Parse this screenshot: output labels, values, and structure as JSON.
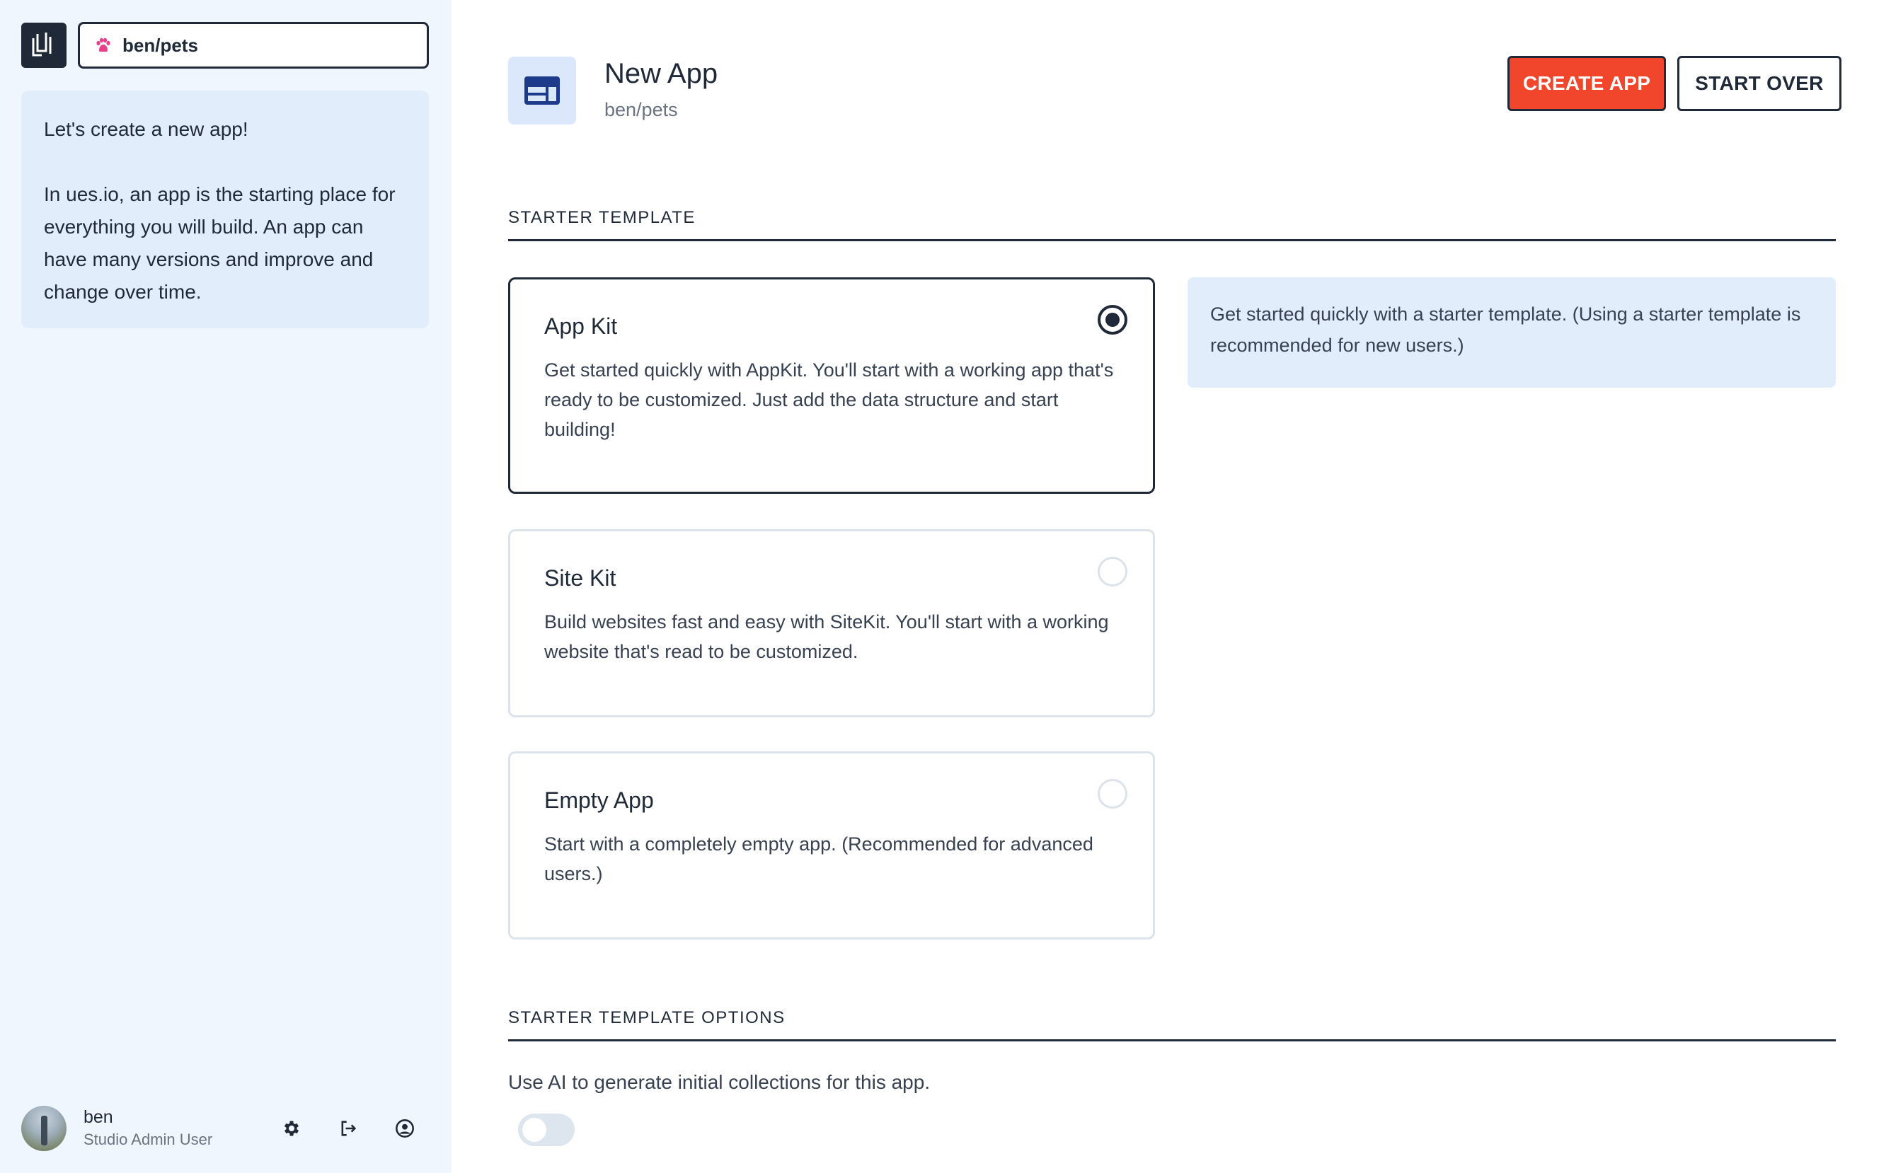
{
  "sidebar": {
    "app_selector": {
      "value": "ben/pets",
      "icon": "paw-icon"
    },
    "intro": {
      "line1": "Let's create a new app!",
      "line2": "In ues.io, an app is the starting place for everything you will build. An app can have many versions and improve and change over time."
    },
    "user": {
      "name": "ben",
      "role": "Studio Admin User",
      "actions": [
        "gear-icon",
        "logout-icon",
        "profile-icon"
      ]
    }
  },
  "header": {
    "title": "New App",
    "subtitle": "ben/pets",
    "create_label": "CREATE APP",
    "start_over_label": "START OVER"
  },
  "starter_template": {
    "section_title": "STARTER TEMPLATE",
    "info": "Get started quickly with a starter template. (Using a starter template is recommended for new users.)",
    "options": [
      {
        "title": "App Kit",
        "description": "Get started quickly with AppKit. You'll start with a working app that's ready to be customized. Just add the data structure and start building!",
        "selected": true
      },
      {
        "title": "Site Kit",
        "description": "Build websites fast and easy with SiteKit. You'll start with a working website that's read to be customized.",
        "selected": false
      },
      {
        "title": "Empty App",
        "description": "Start with a completely empty app. (Recommended for advanced users.)",
        "selected": false
      }
    ]
  },
  "template_options": {
    "section_title": "STARTER TEMPLATE OPTIONS",
    "ai_label": "Use AI to generate initial collections for this app.",
    "ai_enabled": false
  },
  "colors": {
    "accent": "#f2462c",
    "dark": "#1f2937",
    "sidebar_bg": "#f0f6fd",
    "info_bg": "#e2edfb"
  }
}
